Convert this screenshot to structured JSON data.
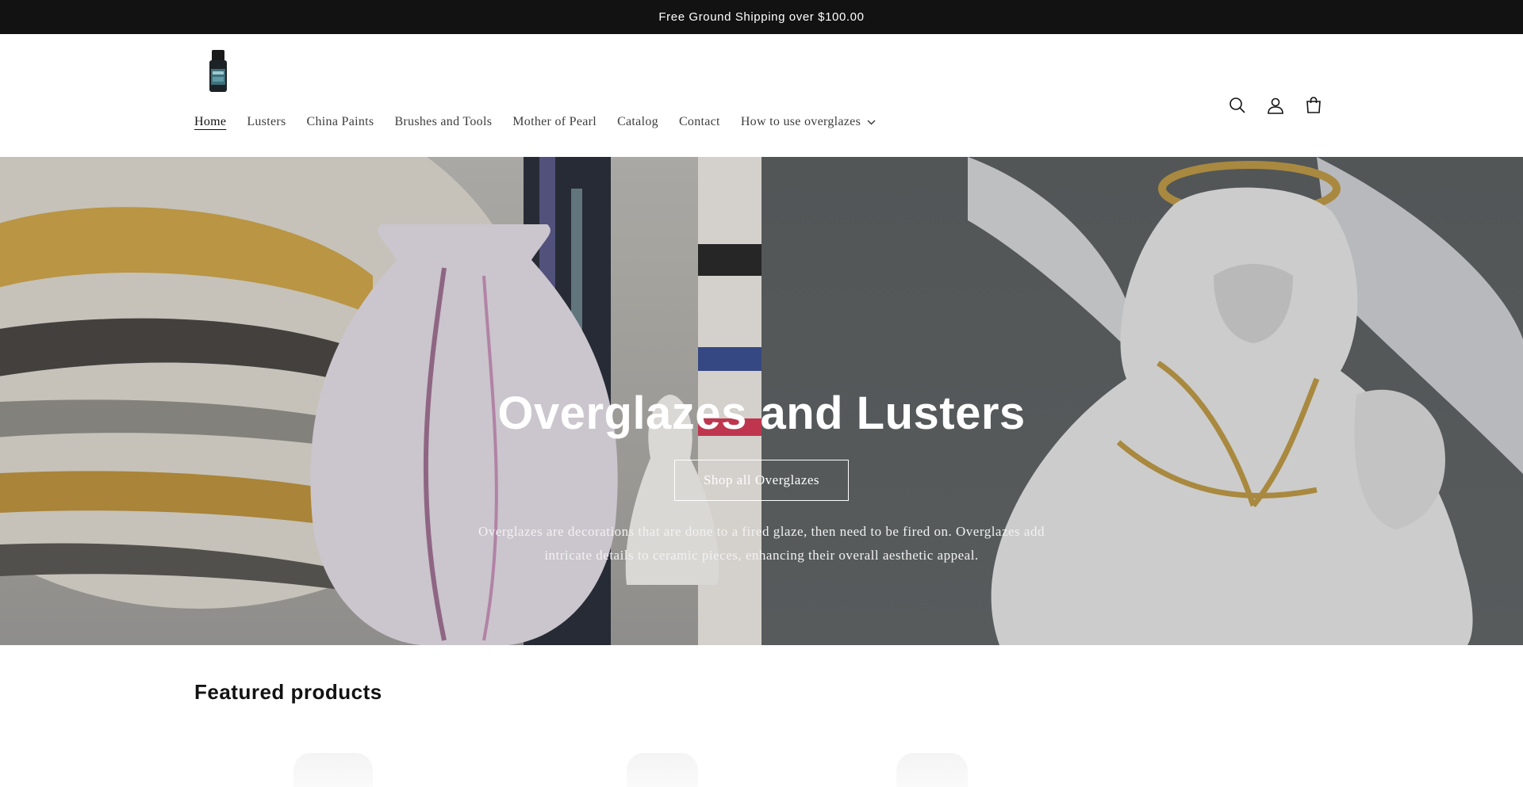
{
  "announcement": {
    "text": "Free Ground Shipping over $100.00"
  },
  "header": {
    "icons": [
      "search-icon",
      "account-icon",
      "cart-icon"
    ]
  },
  "nav": {
    "items": [
      {
        "label": "Home",
        "active": true
      },
      {
        "label": "Lusters"
      },
      {
        "label": "China Paints"
      },
      {
        "label": "Brushes and Tools"
      },
      {
        "label": "Mother of Pearl"
      },
      {
        "label": "Catalog"
      },
      {
        "label": "Contact"
      },
      {
        "label": "How to use overglazes",
        "has_dropdown": true
      }
    ]
  },
  "hero": {
    "title": "Overglazes and Lusters",
    "button_label": "Shop all Overglazes",
    "description": "Overglazes are decorations that are done to a fired glaze, then need to be fired on. Overglazes add intricate details to ceramic pieces, enhancing their overall aesthetic appeal."
  },
  "featured": {
    "title": "Featured products"
  },
  "colors": {
    "announcement_bg": "#121212",
    "text": "#121212",
    "nav_text": "#3d3d3d",
    "hero_right_bg": "#5a5e5f"
  }
}
